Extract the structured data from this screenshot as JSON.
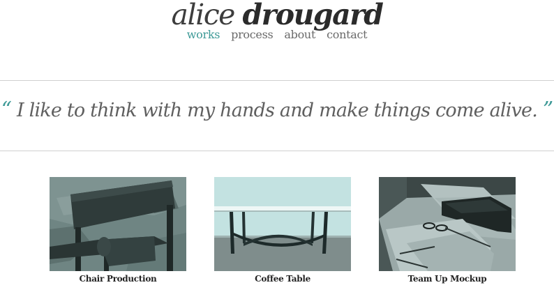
{
  "site": {
    "first_name": "alice",
    "last_name": "drougard"
  },
  "nav": [
    {
      "label": "works",
      "active": true
    },
    {
      "label": "process",
      "active": false
    },
    {
      "label": "about",
      "active": false
    },
    {
      "label": "contact",
      "active": false
    }
  ],
  "quote": {
    "open_mark": "“",
    "text": "I like to think with my hands and make things come alive.",
    "close_mark": "”"
  },
  "works": [
    {
      "caption": "Chair Production"
    },
    {
      "caption": "Coffee Table"
    },
    {
      "caption": "Team Up Mockup"
    }
  ],
  "colors": {
    "accent": "#3e9a97",
    "text": "#5f5f5f",
    "rule": "#cfcfcf"
  }
}
